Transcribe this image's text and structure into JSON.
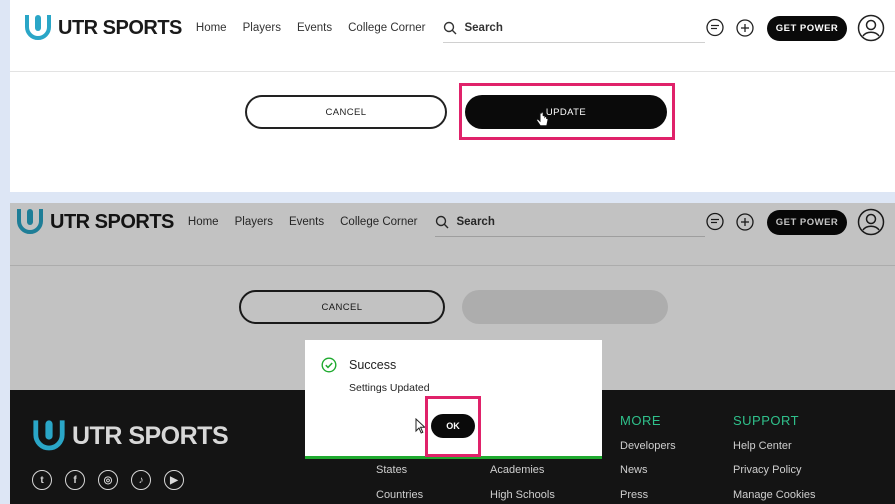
{
  "brand": {
    "name": "UTR SPORTS"
  },
  "nav": [
    {
      "label": "Home"
    },
    {
      "label": "Players"
    },
    {
      "label": "Events"
    },
    {
      "label": "College Corner"
    }
  ],
  "search": {
    "placeholder": "Search"
  },
  "header_actions": {
    "get_power": "GET POWER"
  },
  "form": {
    "cancel_label": "CANCEL",
    "update_label": "UPDATE"
  },
  "dialog": {
    "title": "Success",
    "message": "Settings Updated",
    "ok_label": "OK"
  },
  "footer": {
    "column_partial_a": [
      "States",
      "Countries"
    ],
    "column_partial_b": [
      "Academies",
      "High Schools"
    ],
    "more": {
      "heading": "MORE",
      "links": [
        "Developers",
        "News",
        "Press"
      ]
    },
    "support": {
      "heading": "SUPPORT",
      "links": [
        "Help Center",
        "Privacy Policy",
        "Manage Cookies"
      ]
    },
    "socials": [
      "twitter-icon",
      "facebook-icon",
      "instagram-icon",
      "tiktok-icon",
      "youtube-icon"
    ]
  },
  "colors": {
    "highlight": "#e0226a",
    "brand_teal": "#2aa6c7",
    "footer_accent": "#2fc08b",
    "success": "#1faa2f"
  }
}
